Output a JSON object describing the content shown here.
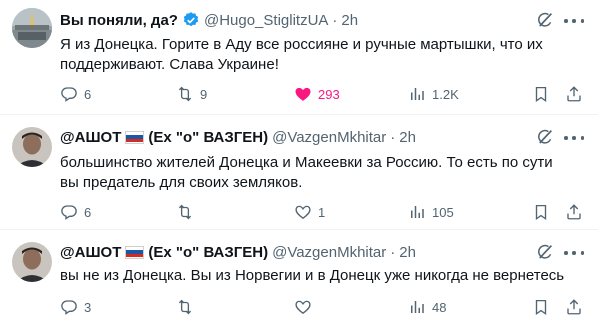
{
  "colors": {
    "text": "#0f1419",
    "muted": "#536471",
    "like_active": "#f91880",
    "verified": "#1d9bf0",
    "divider": "#eff3f4"
  },
  "tweets": [
    {
      "name": "Вы поняли, да?",
      "verified": true,
      "flag": null,
      "handle": "@Hugo_StiglitzUA",
      "dot": "·",
      "time": "2h",
      "text": "Я из Донецка. Горите в Аду все россияне и ручные мартышки, что их поддерживают. Слава Украине!",
      "replies": "6",
      "retweets": "9",
      "likes": "293",
      "liked": true,
      "views": "1.2K"
    },
    {
      "name": "@АШОТ",
      "flag": "ru-flag",
      "name_suffix": "(Ex \"о\" ВАЗГЕН)",
      "handle": "@VazgenMkhitar",
      "dot": "·",
      "time": "2h",
      "text": "большинство жителей Донецка и Макеевки за Россию. То есть по сути вы предатель для своих земляков.",
      "replies": "6",
      "retweets": "",
      "likes": "1",
      "liked": false,
      "views": "105"
    },
    {
      "name": "@АШОТ",
      "flag": "ru-flag",
      "name_suffix": "(Ex \"о\" ВАЗГЕН)",
      "handle": "@VazgenMkhitar",
      "dot": "·",
      "time": "2h",
      "text": "вы не из Донецка. Вы из Норвегии и в Донецк уже никогда не вернетесь",
      "replies": "3",
      "retweets": "",
      "likes": "",
      "liked": false,
      "views": "48"
    }
  ],
  "icons": {
    "reply": "reply-icon",
    "retweet": "retweet-icon",
    "like": "heart-icon",
    "views": "views-icon",
    "bookmark": "bookmark-icon",
    "share": "share-icon",
    "grok": "grok-icon",
    "more": "more-icon",
    "verified": "verified-badge-icon"
  }
}
